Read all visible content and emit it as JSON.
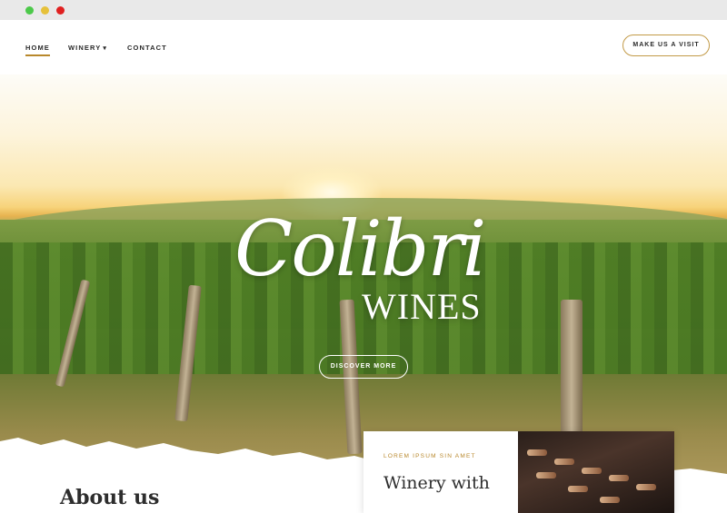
{
  "nav": {
    "items": [
      {
        "label": "HOME",
        "active": true
      },
      {
        "label": "WINERY",
        "has_dropdown": true
      },
      {
        "label": "CONTACT"
      }
    ],
    "cta_label": "MAKE US A VISIT"
  },
  "hero": {
    "logo_script": "Colibri",
    "logo_sub": "WINES",
    "cta_label": "DISCOVER MORE"
  },
  "about": {
    "heading": "About us"
  },
  "card": {
    "eyebrow": "LOREM IPSUM SIN AMET",
    "title": "Winery with"
  },
  "colors": {
    "accent": "#b8882c",
    "traffic_green": "#4cc94a",
    "traffic_yellow": "#e6c13a",
    "traffic_red": "#e02020"
  }
}
